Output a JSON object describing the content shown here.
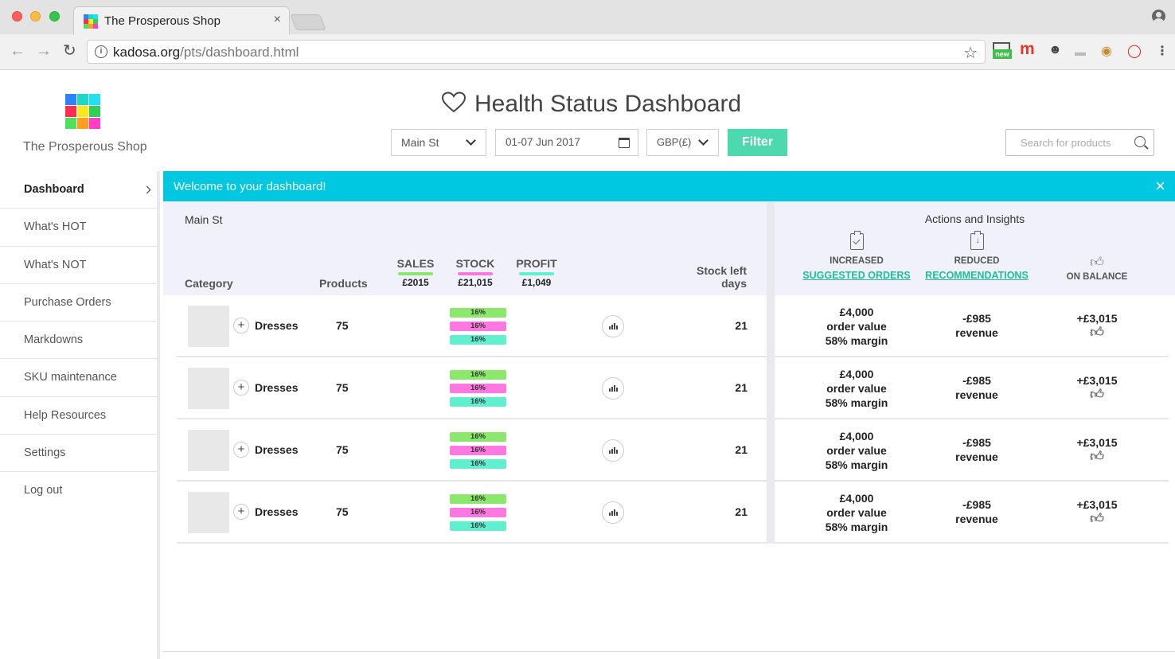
{
  "browser": {
    "tab_title": "The Prosperous Shop",
    "tab_close": "×",
    "url_host": "kadosa.org",
    "url_path": "/pts/dashboard.html",
    "ext_new_badge": "new",
    "ext_m": "m"
  },
  "brand": {
    "name": "The Prosperous Shop",
    "logo_colors": [
      "#2f80ff",
      "#1bd9c9",
      "#22e0f0",
      "#ff2d55",
      "#ffe81a",
      "#2fd05a",
      "#4fe15c",
      "#ff9f1a",
      "#ff3ec8"
    ]
  },
  "header": {
    "title": "Health Status Dashboard",
    "store_select": "Main St",
    "date_range": "01-07 Jun 2017",
    "currency_select": "GBP(£)",
    "filter_label": "Filter",
    "search_placeholder": "Search for products"
  },
  "sidebar": {
    "items": [
      {
        "label": "Dashboard"
      },
      {
        "label": "What's HOT"
      },
      {
        "label": "What's NOT"
      },
      {
        "label": "Purchase Orders"
      },
      {
        "label": "Markdowns"
      },
      {
        "label": "SKU maintenance"
      },
      {
        "label": "Help Resources"
      },
      {
        "label": "Settings"
      },
      {
        "label": "Log out"
      }
    ]
  },
  "banner": {
    "message": "Welcome to your dashboard!",
    "close": "×"
  },
  "table": {
    "store": "Main St",
    "headers": {
      "category": "Category",
      "products": "Products",
      "stock_left_1": "Stock left",
      "stock_left_2": "days"
    },
    "metrics": [
      {
        "label": "SALES",
        "value": "£2015",
        "color": "#8ae86a"
      },
      {
        "label": "STOCK",
        "value": "£21,015",
        "color": "#ff77e0"
      },
      {
        "label": "PROFIT",
        "value": "£1,049",
        "color": "#5ff0cf"
      }
    ],
    "rows": [
      {
        "category": "Dresses",
        "products": "75",
        "sales_pct": "16%",
        "stock_pct": "16%",
        "profit_pct": "16%",
        "days": "21"
      },
      {
        "category": "Dresses",
        "products": "75",
        "sales_pct": "16%",
        "stock_pct": "16%",
        "profit_pct": "16%",
        "days": "21"
      },
      {
        "category": "Dresses",
        "products": "75",
        "sales_pct": "16%",
        "stock_pct": "16%",
        "profit_pct": "16%",
        "days": "21"
      },
      {
        "category": "Dresses",
        "products": "75",
        "sales_pct": "16%",
        "stock_pct": "16%",
        "profit_pct": "16%",
        "days": "21"
      }
    ]
  },
  "insights": {
    "title": "Actions and Insights",
    "increased_label": "INCREASED",
    "increased_link": "SUGGESTED ORDERS",
    "reduced_label": "REDUCED",
    "reduced_link": "RECOMMENDATIONS",
    "balance_label": "ON BALANCE",
    "rows": [
      {
        "order_value": "£4,000",
        "order_value_label": "order value",
        "margin": "58% margin",
        "revenue": "-£985",
        "revenue_label": "revenue",
        "balance": "+£3,015"
      },
      {
        "order_value": "£4,000",
        "order_value_label": "order value",
        "margin": "58% margin",
        "revenue": "-£985",
        "revenue_label": "revenue",
        "balance": "+£3,015"
      },
      {
        "order_value": "£4,000",
        "order_value_label": "order value",
        "margin": "58% margin",
        "revenue": "-£985",
        "revenue_label": "revenue",
        "balance": "+£3,015"
      },
      {
        "order_value": "£4,000",
        "order_value_label": "order value",
        "margin": "58% margin",
        "revenue": "-£985",
        "revenue_label": "revenue",
        "balance": "+£3,015"
      }
    ]
  }
}
